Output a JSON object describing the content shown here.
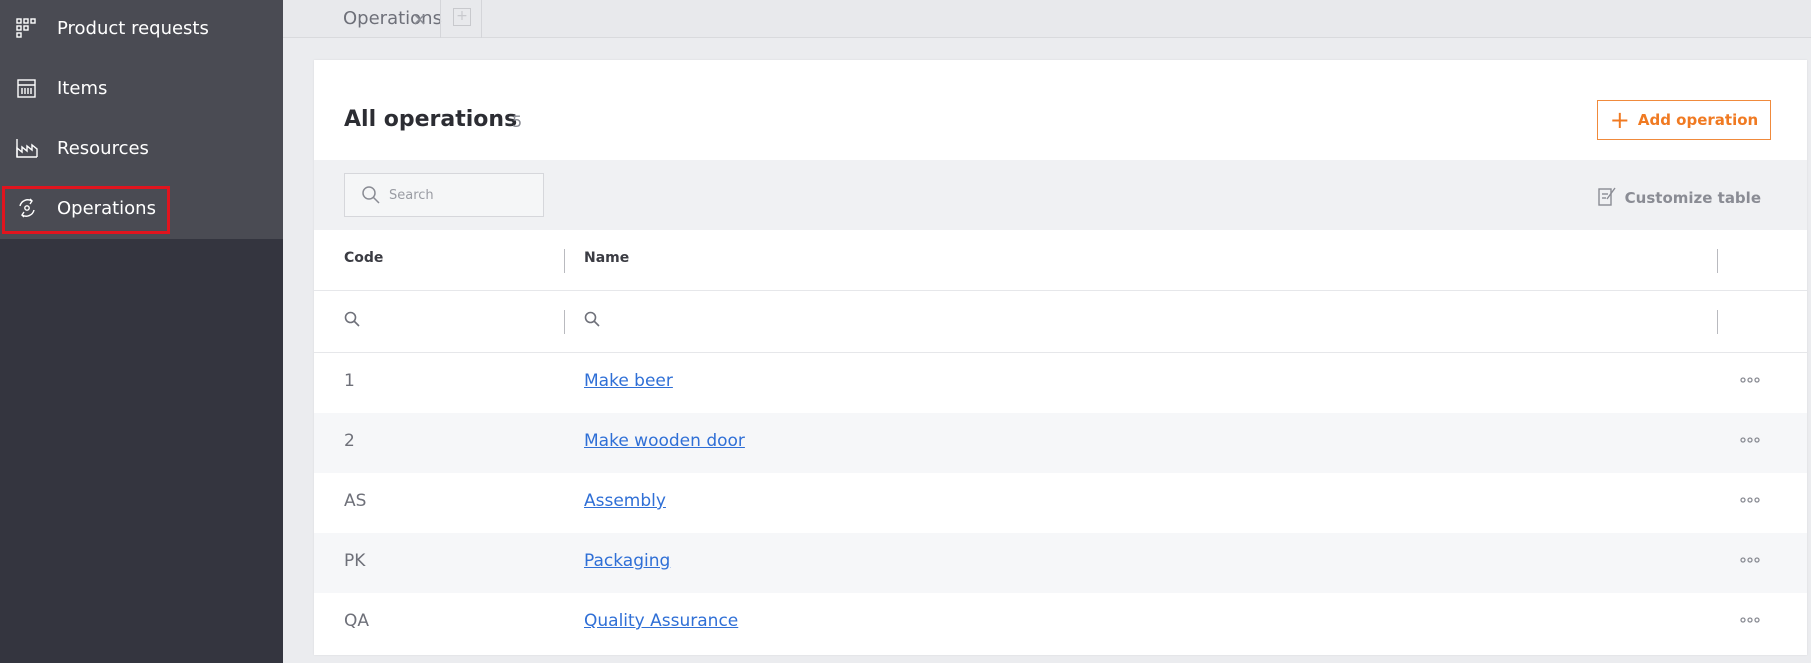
{
  "sidebar": {
    "items": [
      {
        "label": "Product requests",
        "icon": "product-requests-icon"
      },
      {
        "label": "Items",
        "icon": "items-icon"
      },
      {
        "label": "Resources",
        "icon": "factory-icon"
      },
      {
        "label": "Operations",
        "icon": "operations-icon"
      }
    ],
    "active": "Operations",
    "highlight_color": "#e0141e"
  },
  "tabs": [
    {
      "label": "Operations",
      "close": "×"
    }
  ],
  "tab_add_label": "+",
  "panel": {
    "title": "All operations",
    "count": "5",
    "add_button_label": "Add operation",
    "add_button_icon": "+",
    "search_placeholder": "Search",
    "customize_label": "Customize table"
  },
  "table": {
    "columns": [
      "Code",
      "Name"
    ],
    "rows": [
      {
        "code": "1",
        "name": "Make beer"
      },
      {
        "code": "2",
        "name": "Make wooden door"
      },
      {
        "code": "AS",
        "name": "Assembly"
      },
      {
        "code": "PK",
        "name": "Packaging"
      },
      {
        "code": "QA",
        "name": "Quality Assurance"
      }
    ]
  },
  "colors": {
    "accent": "#f07a22",
    "link": "#2f6fd6",
    "sidebar_bg": "#34353f"
  }
}
